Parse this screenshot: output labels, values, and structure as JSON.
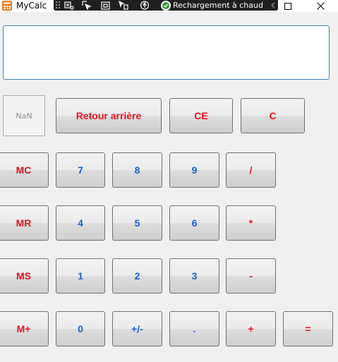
{
  "window": {
    "title": "MyCalc",
    "hot_reload_label": "Rechargement à chaud"
  },
  "display": {
    "value": ""
  },
  "memory_indicator": {
    "value": "NaN"
  },
  "buttons": {
    "backspace": "Retour arrière",
    "ce": "CE",
    "c": "C",
    "mc": "MC",
    "mr": "MR",
    "ms": "MS",
    "mplus": "M+",
    "d7": "7",
    "d8": "8",
    "d9": "9",
    "d4": "4",
    "d5": "5",
    "d6": "6",
    "d1": "1",
    "d2": "2",
    "d3": "3",
    "d0": "0",
    "negate": "+/-",
    "decimal": ".",
    "divide": "/",
    "multiply": "*",
    "subtract": "-",
    "add": "+",
    "equals": "="
  },
  "colors": {
    "function_text": "#e8141c",
    "digit_text": "#1464c8",
    "display_border": "#3c7fb1",
    "toolbar_bg": "#1f1f1f"
  }
}
